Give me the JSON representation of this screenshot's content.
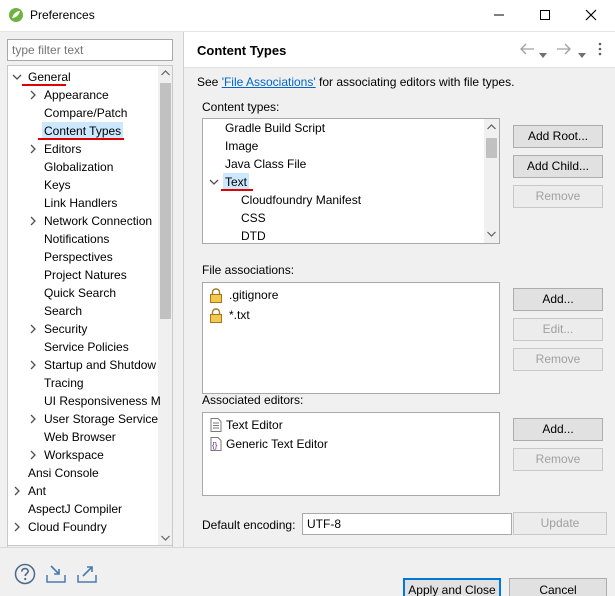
{
  "window": {
    "title": "Preferences"
  },
  "filter": {
    "placeholder": "type filter text"
  },
  "tree": [
    {
      "label": "General",
      "level": 0,
      "expanded": true,
      "underline": true
    },
    {
      "label": "Appearance",
      "level": 1,
      "arrow": true
    },
    {
      "label": "Compare/Patch",
      "level": 1
    },
    {
      "label": "Content Types",
      "level": 1,
      "selected": true,
      "underline": true
    },
    {
      "label": "Editors",
      "level": 1,
      "arrow": true
    },
    {
      "label": "Globalization",
      "level": 1
    },
    {
      "label": "Keys",
      "level": 1
    },
    {
      "label": "Link Handlers",
      "level": 1
    },
    {
      "label": "Network Connection",
      "level": 1,
      "arrow": true
    },
    {
      "label": "Notifications",
      "level": 1
    },
    {
      "label": "Perspectives",
      "level": 1
    },
    {
      "label": "Project Natures",
      "level": 1
    },
    {
      "label": "Quick Search",
      "level": 1
    },
    {
      "label": "Search",
      "level": 1
    },
    {
      "label": "Security",
      "level": 1,
      "arrow": true
    },
    {
      "label": "Service Policies",
      "level": 1
    },
    {
      "label": "Startup and Shutdow",
      "level": 1,
      "arrow": true
    },
    {
      "label": "Tracing",
      "level": 1
    },
    {
      "label": "UI Responsiveness M",
      "level": 1
    },
    {
      "label": "User Storage Service",
      "level": 1,
      "arrow": true
    },
    {
      "label": "Web Browser",
      "level": 1
    },
    {
      "label": "Workspace",
      "level": 1,
      "arrow": true
    },
    {
      "label": "Ansi Console",
      "level": 0
    },
    {
      "label": "Ant",
      "level": 0,
      "arrow": true
    },
    {
      "label": "AspectJ Compiler",
      "level": 0
    },
    {
      "label": "Cloud Foundry",
      "level": 0,
      "arrow": true
    }
  ],
  "page": {
    "title": "Content Types",
    "see_prefix": "See ",
    "see_link": "'File Associations'",
    "see_suffix": " for associating editors with file types.",
    "content_types_label": "Content types:",
    "content_types": [
      {
        "label": "Gradle Build Script",
        "level": 0
      },
      {
        "label": "Image",
        "level": 0
      },
      {
        "label": "Java Class File",
        "level": 0
      },
      {
        "label": "Text",
        "level": 0,
        "expanded": true,
        "selected": true
      },
      {
        "label": "Cloudfoundry Manifest",
        "level": 1
      },
      {
        "label": "CSS",
        "level": 1
      },
      {
        "label": "DTD",
        "level": 1
      }
    ],
    "content_buttons": {
      "add_root": "Add Root...",
      "add_child": "Add Child...",
      "remove": "Remove"
    },
    "file_assoc_label": "File associations:",
    "file_associations": [
      ".gitignore",
      "*.txt"
    ],
    "file_buttons": {
      "add": "Add...",
      "edit": "Edit...",
      "remove": "Remove"
    },
    "assoc_editors_label": "Associated editors:",
    "editors": [
      "Text Editor",
      "Generic Text Editor"
    ],
    "editor_buttons": {
      "add": "Add...",
      "remove": "Remove"
    },
    "encoding_label": "Default encoding:",
    "encoding_value": "UTF-8",
    "update": "Update"
  },
  "footer": {
    "apply_close": "Apply and Close",
    "cancel": "Cancel"
  },
  "icons": [
    "app-icon",
    "minimize-icon",
    "maximize-icon",
    "close-icon",
    "back-icon",
    "forward-icon",
    "menu-icon",
    "help-icon",
    "import-icon",
    "export-icon",
    "lock-icon",
    "text-editor-icon",
    "generic-editor-icon"
  ],
  "colors": {
    "accent": "#0078d7",
    "link": "#0066cc",
    "selection": "#cce8ff",
    "highlight_underline": "#e00000"
  }
}
